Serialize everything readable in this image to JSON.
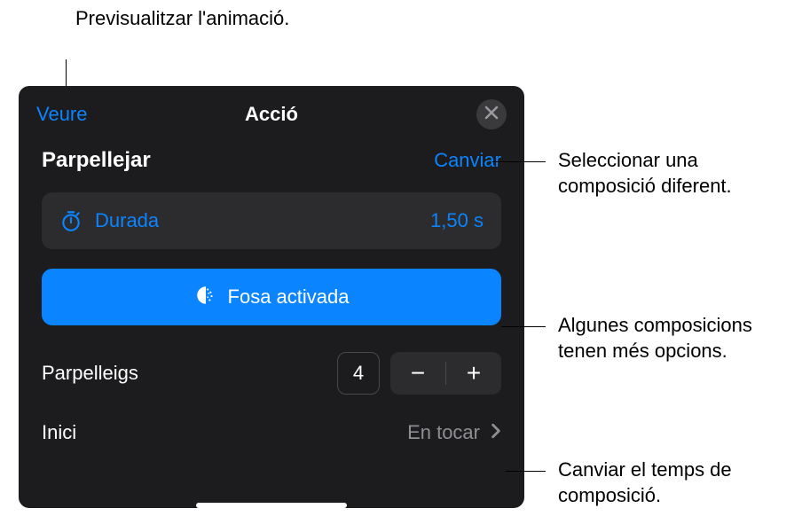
{
  "header": {
    "preview_label": "Veure",
    "title": "Acció"
  },
  "effect": {
    "name": "Parpellejar",
    "change_label": "Canviar"
  },
  "duration": {
    "label": "Durada",
    "value": "1,50 s"
  },
  "option": {
    "label": "Fosa activada"
  },
  "stepper": {
    "label": "Parpelleigs",
    "value": "4",
    "minus": "−",
    "plus": "+"
  },
  "start": {
    "label": "Inici",
    "value": "En tocar"
  },
  "callouts": {
    "preview": "Previsualitzar l'animació.",
    "change": "Seleccionar una composició diferent.",
    "options": "Algunes composicions tenen més opcions.",
    "timing": "Canviar el temps de composició."
  }
}
